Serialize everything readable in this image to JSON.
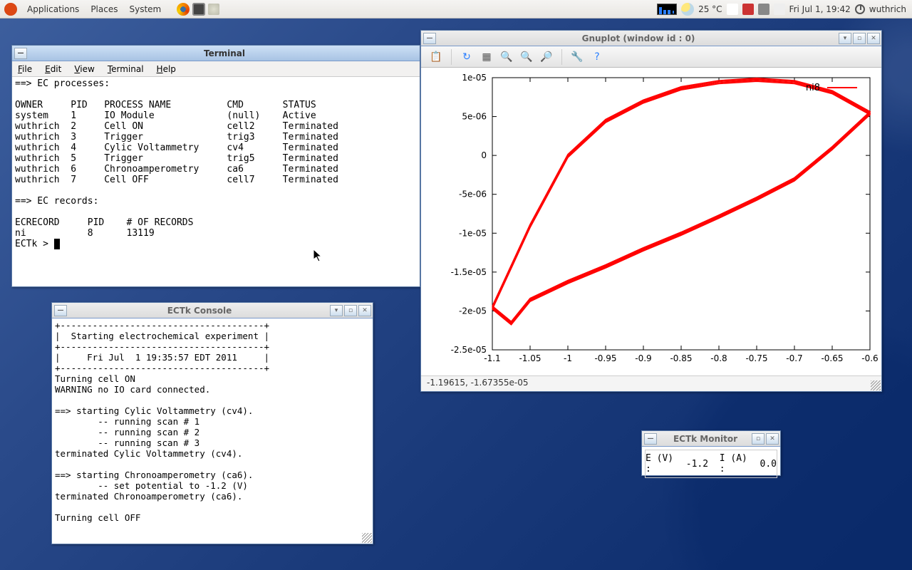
{
  "panel": {
    "menu": [
      "Applications",
      "Places",
      "System"
    ],
    "temp": "25 °C",
    "clock": "Fri Jul  1, 19:42",
    "user": "wuthrich"
  },
  "terminal": {
    "title": "Terminal",
    "menus": [
      "File",
      "Edit",
      "View",
      "Terminal",
      "Help"
    ],
    "lines": [
      "==> EC processes:",
      "",
      "OWNER     PID   PROCESS NAME          CMD       STATUS",
      "system    1     IO Module             (null)    Active",
      "wuthrich  2     Cell ON               cell2     Terminated",
      "wuthrich  3     Trigger               trig3     Terminated",
      "wuthrich  4     Cylic Voltammetry     cv4       Terminated",
      "wuthrich  5     Trigger               trig5     Terminated",
      "wuthrich  6     Chronoamperometry     ca6       Terminated",
      "wuthrich  7     Cell OFF              cell7     Terminated",
      "",
      "==> EC records:",
      "",
      "ECRECORD     PID    # OF RECORDS",
      "ni           8      13119",
      ""
    ],
    "prompt": "ECTk > "
  },
  "ectk": {
    "title": "ECTk Console",
    "lines": [
      "+--------------------------------------+",
      "|  Starting electrochemical experiment |",
      "+--------------------------------------+",
      "|     Fri Jul  1 19:35:57 EDT 2011     |",
      "+--------------------------------------+",
      "Turning cell ON",
      "WARNING no IO card connected.",
      "",
      "==> starting Cylic Voltammetry (cv4).",
      "        -- running scan # 1",
      "        -- running scan # 2",
      "        -- running scan # 3",
      "terminated Cylic Voltammetry (cv4).",
      "",
      "==> starting Chronoamperometry (ca6).",
      "        -- set potential to -1.2 (V)",
      "terminated Chronoamperometry (ca6).",
      "",
      "Turning cell OFF",
      ""
    ]
  },
  "gnuplot": {
    "title": "Gnuplot (window id : 0)",
    "legend": "ni8",
    "status": "-1.19615, -1.67355e-05",
    "xticks": [
      "-1.1",
      "-1.05",
      "-1",
      "-0.95",
      "-0.9",
      "-0.85",
      "-0.8",
      "-0.75",
      "-0.7",
      "-0.65",
      "-0.6"
    ],
    "yticks": [
      "1e-05",
      "5e-06",
      "0",
      "-5e-06",
      "-1e-05",
      "-1.5e-05",
      "-2e-05",
      "-2.5e-05"
    ]
  },
  "chart_data": {
    "type": "line",
    "title": "",
    "legend": [
      "ni8"
    ],
    "xlabel": "",
    "ylabel": "",
    "xlim": [
      -1.1,
      -0.6
    ],
    "ylim": [
      -2.5e-05,
      1e-05
    ],
    "series": [
      {
        "name": "ni8",
        "x": [
          -1.1,
          -1.05,
          -1.0,
          -0.95,
          -0.9,
          -0.85,
          -0.8,
          -0.75,
          -0.7,
          -0.65,
          -0.6,
          -0.6,
          -0.65,
          -0.7,
          -0.75,
          -0.8,
          -0.85,
          -0.9,
          -0.95,
          -1.0,
          -1.05,
          -1.075,
          -1.1
        ],
        "y": [
          -1.95e-05,
          -9e-06,
          0.0,
          4.5e-06,
          7e-06,
          8.7e-06,
          9.5e-06,
          9.8e-06,
          9.5e-06,
          8.2e-06,
          5.5e-06,
          5.5e-06,
          1e-06,
          -3e-06,
          -5.5e-06,
          -7.8e-06,
          -1e-05,
          -1.2e-05,
          -1.42e-05,
          -1.62e-05,
          -1.85e-05,
          -2.15e-05,
          -1.95e-05
        ]
      }
    ]
  },
  "monitor": {
    "title": "ECTk Monitor",
    "labelE": "E (V) :",
    "valE": "-1.2",
    "labelI": "I (A) :",
    "valI": "0.0"
  }
}
